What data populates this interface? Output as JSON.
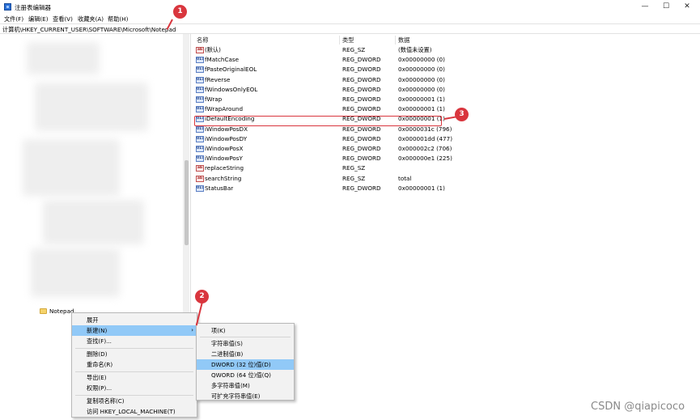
{
  "window": {
    "title": "注册表编辑器",
    "min_label": "—",
    "max_label": "☐",
    "close_label": "✕"
  },
  "menu": [
    "文件(F)",
    "编辑(E)",
    "查看(V)",
    "收藏夹(A)",
    "帮助(H)"
  ],
  "address": "计算机\\HKEY_CURRENT_USER\\SOFTWARE\\Microsoft\\Notepad",
  "tree": {
    "selected_node": "Notepad"
  },
  "list": {
    "headers": {
      "name": "名称",
      "type": "类型",
      "data": "数据"
    },
    "rows": [
      {
        "icon": "ab",
        "name": "(默认)",
        "type": "REG_SZ",
        "data": "(数值未设置)"
      },
      {
        "icon": "011",
        "name": "fMatchCase",
        "type": "REG_DWORD",
        "data": "0x00000000 (0)"
      },
      {
        "icon": "011",
        "name": "fPasteOriginalEOL",
        "type": "REG_DWORD",
        "data": "0x00000000 (0)"
      },
      {
        "icon": "011",
        "name": "fReverse",
        "type": "REG_DWORD",
        "data": "0x00000000 (0)"
      },
      {
        "icon": "011",
        "name": "fWindowsOnlyEOL",
        "type": "REG_DWORD",
        "data": "0x00000000 (0)"
      },
      {
        "icon": "011",
        "name": "fWrap",
        "type": "REG_DWORD",
        "data": "0x00000001 (1)"
      },
      {
        "icon": "011",
        "name": "fWrapAround",
        "type": "REG_DWORD",
        "data": "0x00000001 (1)"
      },
      {
        "icon": "011",
        "name": "iDefaultEncoding",
        "type": "REG_DWORD",
        "data": "0x00000001 (1)"
      },
      {
        "icon": "011",
        "name": "iWindowPosDX",
        "type": "REG_DWORD",
        "data": "0x0000031c (796)"
      },
      {
        "icon": "011",
        "name": "iWindowPosDY",
        "type": "REG_DWORD",
        "data": "0x000001dd (477)"
      },
      {
        "icon": "011",
        "name": "iWindowPosX",
        "type": "REG_DWORD",
        "data": "0x000002c2 (706)"
      },
      {
        "icon": "011",
        "name": "iWindowPosY",
        "type": "REG_DWORD",
        "data": "0x000000e1 (225)"
      },
      {
        "icon": "ab",
        "name": "replaceString",
        "type": "REG_SZ",
        "data": ""
      },
      {
        "icon": "ab",
        "name": "searchString",
        "type": "REG_SZ",
        "data": "total"
      },
      {
        "icon": "011",
        "name": "StatusBar",
        "type": "REG_DWORD",
        "data": "0x00000001 (1)"
      }
    ]
  },
  "context_menu": {
    "items": [
      "展开",
      "新建(N)",
      "查找(F)...",
      "删除(D)",
      "重命名(R)",
      "导出(E)",
      "权限(P)...",
      "复制项名称(C)",
      "访问 HKEY_LOCAL_MACHINE(T)"
    ],
    "submenu_arrow": "›"
  },
  "submenu": {
    "items": [
      "项(K)",
      "字符串值(S)",
      "二进制值(B)",
      "DWORD (32 位)值(D)",
      "QWORD (64 位)值(Q)",
      "多字符串值(M)",
      "可扩充字符串值(E)"
    ]
  },
  "annotations": {
    "marker1": "1",
    "marker2": "2",
    "marker3": "3"
  },
  "watermark": "CSDN @qiapicoco",
  "colors": {
    "accent_red": "#d9363e",
    "menu_highlight": "#91c9f7"
  }
}
